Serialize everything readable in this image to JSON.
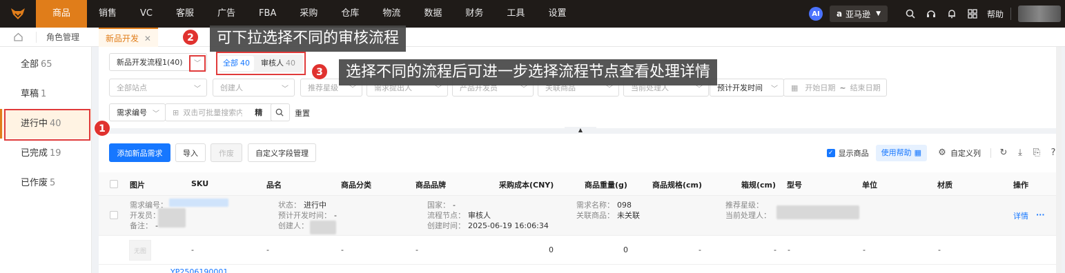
{
  "nav": {
    "items": [
      "商品",
      "销售",
      "VC",
      "客服",
      "广告",
      "FBA",
      "采购",
      "仓库",
      "物流",
      "数据",
      "财务",
      "工具",
      "设置"
    ],
    "ai_label": "AI",
    "store_label": "亚马逊",
    "help_label": "帮助"
  },
  "tabs": {
    "role": "角色管理",
    "active": "新品开发"
  },
  "sidebar": {
    "items": [
      {
        "label": "全部",
        "count": "65"
      },
      {
        "label": "草稿",
        "count": "1"
      },
      {
        "label": "进行中",
        "count": "40"
      },
      {
        "label": "已完成",
        "count": "19"
      },
      {
        "label": "已作废",
        "count": "5"
      }
    ]
  },
  "filters": {
    "flow_select": "新品开发流程1(40)",
    "seg_all": "全部",
    "seg_all_count": "40",
    "seg_reviewer": "审核人",
    "seg_reviewer_count": "40",
    "site": "全部站点",
    "creator": "创建人",
    "rating": "推荐星级",
    "proposer": "需求提出人",
    "developer": "产品开发员",
    "linked": "关联商品",
    "handler": "当前处理人",
    "date_type": "预计开发时间",
    "start_date": "开始日期",
    "tilde": "~",
    "end_date": "结束日期",
    "search_type": "需求编号",
    "search_placeholder": "双击可批量搜索内容",
    "precise": "精",
    "reset": "重置"
  },
  "toolbar": {
    "add": "添加新品需求",
    "import": "导入",
    "void": "作废",
    "custom_fields": "自定义字段管理",
    "show_products": "显示商品",
    "use_help": "使用帮助",
    "custom_cols": "自定义列"
  },
  "table": {
    "headers": [
      "图片",
      "SKU",
      "品名",
      "商品分类",
      "商品品牌",
      "采购成本(CNY)",
      "商品重量(g)",
      "商品规格(cm)",
      "箱规(cm)",
      "型号",
      "单位",
      "材质",
      "操作"
    ],
    "group": {
      "k_code": "需求编号：",
      "k_dev": "开发员：",
      "k_note": "备注：",
      "v_note": "-",
      "k_status": "状态：",
      "v_status": "进行中",
      "k_expect": "预计开发时间：",
      "v_expect": "-",
      "k_creator": "创建人：",
      "k_country": "国家：",
      "v_country": "-",
      "k_node": "流程节点：",
      "v_node": "审核人",
      "k_created": "创建时间：",
      "v_created": "2025-06-19 16:06:34",
      "k_name": "需求名称：",
      "v_name": "098",
      "k_linked": "关联商品：",
      "v_linked": "未关联",
      "k_rating": "推荐星级：",
      "k_handler": "当前处理人：",
      "detail": "详情",
      "more": "···"
    },
    "row": {
      "noimg": "无图",
      "sku": "-",
      "name": "-",
      "category": "-",
      "brand": "-",
      "cost": "0",
      "weight": "0",
      "spec": "-",
      "box": "-",
      "model": "-",
      "unit": "-",
      "material": "-"
    },
    "next_row": {
      "code": "YP2506190001"
    }
  },
  "callouts": {
    "c1": {
      "num": "1"
    },
    "c2": {
      "num": "2",
      "text": "可下拉选择不同的审核流程"
    },
    "c3": {
      "num": "3",
      "text": "选择不同的流程后可进一步选择流程节点查看处理详情"
    }
  },
  "colors": {
    "brand": "#e07d1a",
    "primary": "#1677ff",
    "annotation": "#e03a3a"
  }
}
